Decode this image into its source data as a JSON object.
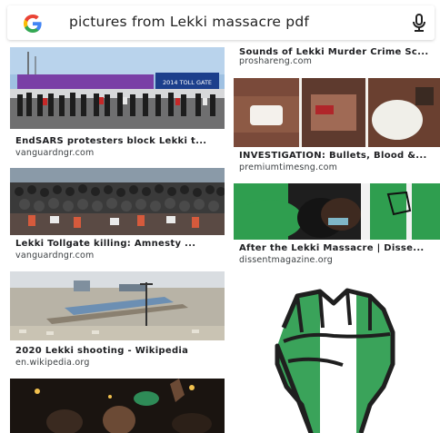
{
  "search": {
    "query": "pictures from Lekki massacre pdf",
    "logo_icon": "google-g-icon",
    "mic_icon": "microphone-icon"
  },
  "results_left": [
    {
      "title": "EndSARS protesters block Lekki t...",
      "source": "vanguardngr.com"
    },
    {
      "title": "Lekki Tollgate killing: Amnesty ...",
      "source": "vanguardngr.com"
    },
    {
      "title": "2020 Lekki shooting - Wikipedia",
      "source": "en.wikipedia.org"
    }
  ],
  "results_right": [
    {
      "title": "Sounds of Lekki Murder Crime Sc...",
      "source": "proshareng.com"
    },
    {
      "title": "INVESTIGATION: Bullets, Blood &...",
      "source": "premiumtimesng.com"
    },
    {
      "title": "After the Lekki Massacre | Disse...",
      "source": "dissentmagazine.org"
    }
  ],
  "image_text": {
    "billboard": "2014 TOLL GATE"
  },
  "colors": {
    "nigeria_green": "#2f9e4f",
    "google_blue": "#4285F4",
    "google_red": "#EA4335",
    "google_yellow": "#FBBC05",
    "google_green": "#34A853"
  }
}
